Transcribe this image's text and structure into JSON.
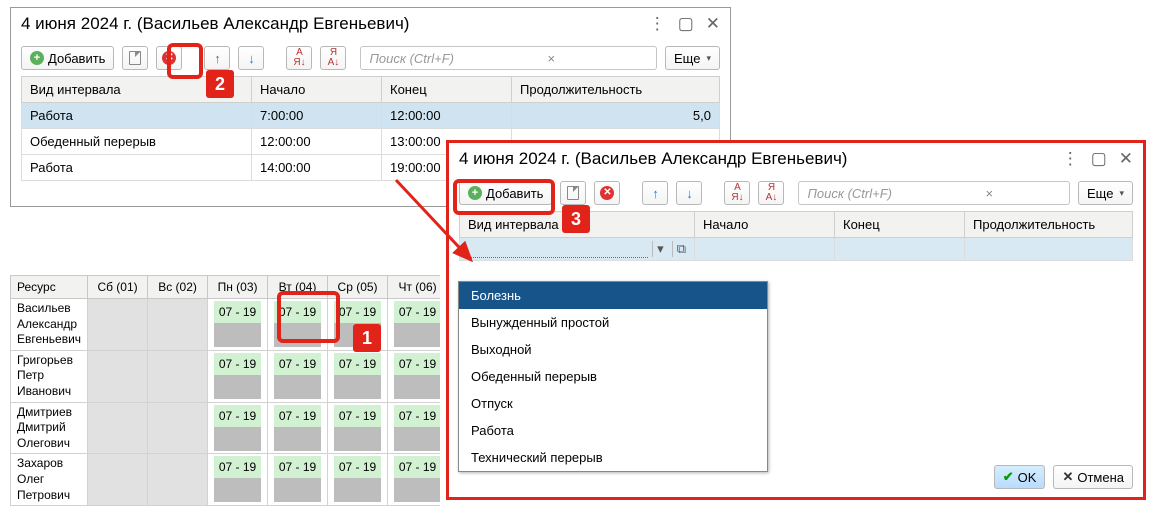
{
  "win1": {
    "title": "4 июня 2024 г. (Васильев Александр Евгеньевич)",
    "add": "Добавить",
    "more": "Еще",
    "search_ph": "Поиск (Ctrl+F)",
    "cols": {
      "type": "Вид интервала",
      "start": "Начало",
      "end": "Конец",
      "dur": "Продолжительность"
    },
    "rows": [
      {
        "type": "Работа",
        "start": "7:00:00",
        "end": "12:00:00",
        "dur": "5,0"
      },
      {
        "type": "Обеденный перерыв",
        "start": "12:00:00",
        "end": "13:00:00",
        "dur": ""
      },
      {
        "type": "Работа",
        "start": "14:00:00",
        "end": "19:00:00",
        "dur": ""
      }
    ]
  },
  "sched": {
    "head": {
      "res": "Ресурс",
      "d1": "Сб (01)",
      "d2": "Вс (02)",
      "d3": "Пн (03)",
      "d4": "Вт (04)",
      "d5": "Ср (05)",
      "d6": "Чт (06)"
    },
    "cell": "07 - 19",
    "names": [
      "Васильев Александр Евгеньевич",
      "Григорьев Петр Иванович",
      "Дмитриев Дмитрий Олегович",
      "Захаров Олег Петрович"
    ]
  },
  "win2": {
    "title": "4 июня 2024 г. (Васильев Александр Евгеньевич)",
    "add": "Добавить",
    "more": "Еще",
    "search_ph": "Поиск (Ctrl+F)",
    "cols": {
      "type": "Вид интервала",
      "start": "Начало",
      "end": "Конец",
      "dur": "Продолжительность"
    },
    "ok": "OK",
    "cancel": "Отмена",
    "options": [
      "Болезнь",
      "Вынужденный простой",
      "Выходной",
      "Обеденный перерыв",
      "Отпуск",
      "Работа",
      "Технический перерыв"
    ]
  },
  "badges": {
    "b1": "1",
    "b2": "2",
    "b3": "3"
  }
}
